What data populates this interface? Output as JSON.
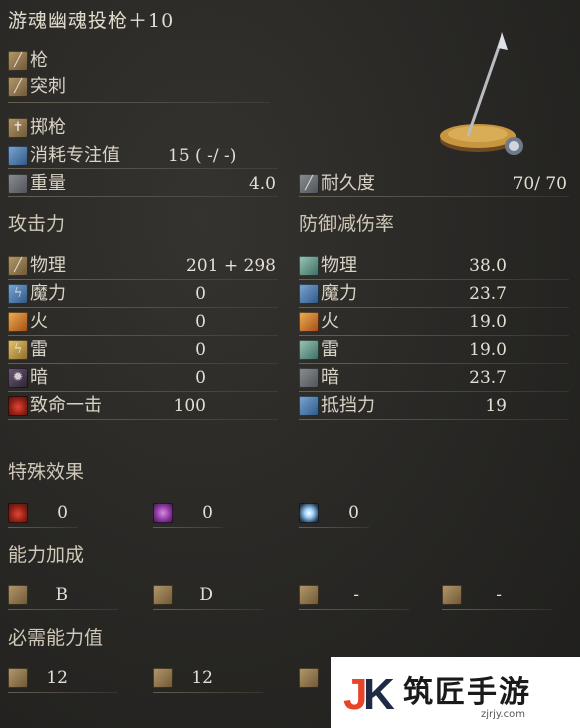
{
  "weapon": {
    "name": "游魂幽魂投枪＋10",
    "type": "枪",
    "attack_type": "突刺",
    "skill": "掷枪",
    "fp_cost_label": "消耗专注值",
    "fp_cost_value": "15 (  -/  -)",
    "weight_label": "重量",
    "weight_value": "4.0",
    "durability_label": "耐久度",
    "durability_value": "70/   70"
  },
  "attack": {
    "header": "攻击力",
    "rows": [
      {
        "label": "物理",
        "value": "201 +   298",
        "icon": "physical-attack-icon"
      },
      {
        "label": "魔力",
        "value": "0",
        "icon": "magic-attack-icon"
      },
      {
        "label": "火",
        "value": "0",
        "icon": "fire-attack-icon"
      },
      {
        "label": "雷",
        "value": "0",
        "icon": "lightning-attack-icon"
      },
      {
        "label": "暗",
        "value": "0",
        "icon": "dark-attack-icon"
      },
      {
        "label": "致命一击",
        "value": "100",
        "icon": "critical-icon"
      }
    ]
  },
  "defense": {
    "header": "防御减伤率",
    "rows": [
      {
        "label": "物理",
        "value": "38.0",
        "icon": "physical-defense-icon"
      },
      {
        "label": "魔力",
        "value": "23.7",
        "icon": "magic-defense-icon"
      },
      {
        "label": "火",
        "value": "19.0",
        "icon": "fire-defense-icon"
      },
      {
        "label": "雷",
        "value": "19.0",
        "icon": "lightning-defense-icon"
      },
      {
        "label": "暗",
        "value": "23.7",
        "icon": "dark-defense-icon"
      },
      {
        "label": "抵挡力",
        "value": "19",
        "icon": "stability-icon"
      }
    ]
  },
  "effects": {
    "header": "特殊效果",
    "items": [
      {
        "value": "0",
        "icon": "bleed-icon"
      },
      {
        "value": "0",
        "icon": "poison-icon"
      },
      {
        "value": "0",
        "icon": "frost-icon"
      }
    ]
  },
  "scaling": {
    "header": "能力加成",
    "items": [
      {
        "value": "B",
        "icon": "strength-icon"
      },
      {
        "value": "D",
        "icon": "dexterity-icon"
      },
      {
        "value": "-",
        "icon": "intelligence-icon"
      },
      {
        "value": "-",
        "icon": "faith-icon"
      }
    ]
  },
  "requirements": {
    "header": "必需能力值",
    "items": [
      {
        "value": "12",
        "icon": "strength-req-icon"
      },
      {
        "value": "12",
        "icon": "dexterity-req-icon"
      }
    ]
  },
  "watermark": {
    "text": "筑匠手游",
    "url": "zjrjy.com"
  }
}
